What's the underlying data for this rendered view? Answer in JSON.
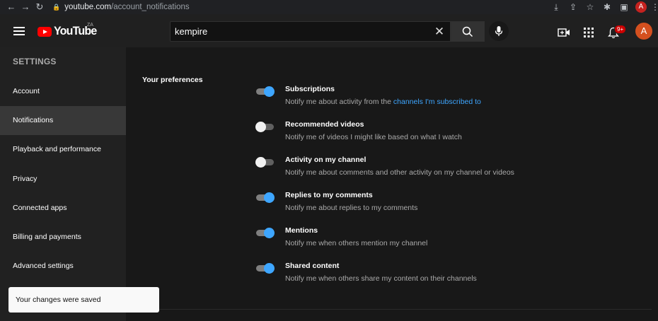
{
  "browser": {
    "url_host": "youtube.com",
    "url_path": "/account_notifications",
    "avatar_letter": "A"
  },
  "header": {
    "logo_text": "YouTube",
    "country_code": "ZA",
    "search_value": "kempire",
    "notification_count": "9+",
    "avatar_letter": "A"
  },
  "sidebar": {
    "title": "SETTINGS",
    "items": [
      {
        "label": "Account"
      },
      {
        "label": "Notifications"
      },
      {
        "label": "Playback and performance"
      },
      {
        "label": "Privacy"
      },
      {
        "label": "Connected apps"
      },
      {
        "label": "Billing and payments"
      },
      {
        "label": "Advanced settings"
      }
    ]
  },
  "toast": {
    "text": "Your changes were saved"
  },
  "main": {
    "section_title": "Your preferences",
    "preferences": [
      {
        "title": "Subscriptions",
        "desc": "Notify me about activity from the ",
        "link": "channels I'm subscribed to",
        "enabled": true
      },
      {
        "title": "Recommended videos",
        "desc": "Notify me of videos I might like based on what I watch",
        "enabled": false
      },
      {
        "title": "Activity on my channel",
        "desc": "Notify me about comments and other activity on my channel or videos",
        "enabled": false
      },
      {
        "title": "Replies to my comments",
        "desc": "Notify me about replies to my comments",
        "enabled": true
      },
      {
        "title": "Mentions",
        "desc": "Notify me when others mention my channel",
        "enabled": true
      },
      {
        "title": "Shared content",
        "desc": "Notify me when others share my content on their channels",
        "enabled": true
      }
    ]
  },
  "colors": {
    "accent_blue": "#3ea6ff",
    "brand_red": "#ff0000",
    "badge_red": "#cc0000"
  }
}
